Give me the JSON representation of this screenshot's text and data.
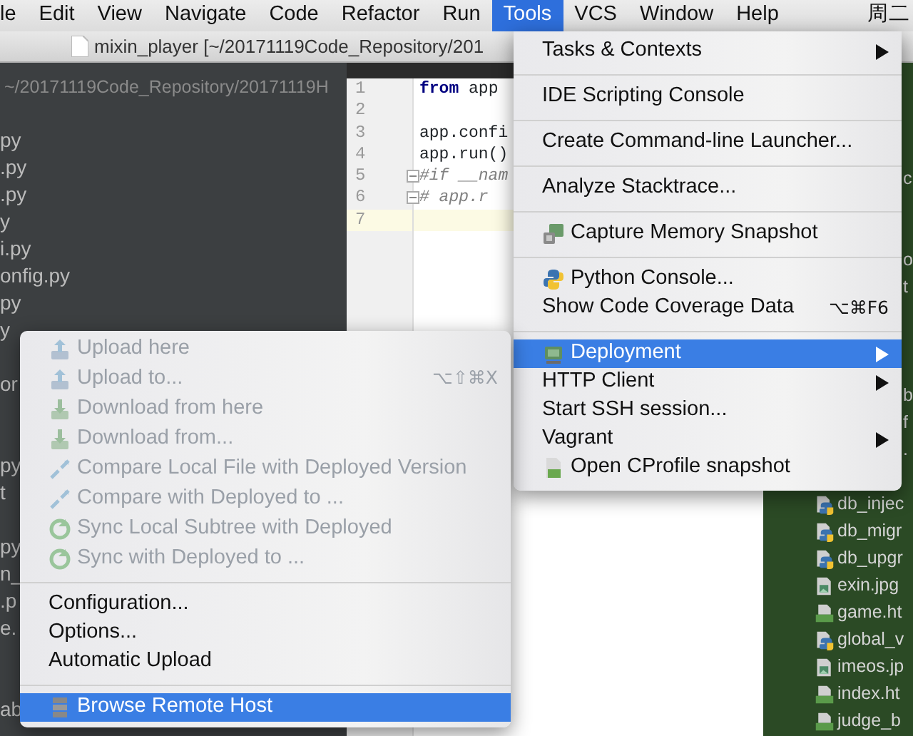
{
  "menubar": {
    "items": [
      {
        "label": "le",
        "selected": false
      },
      {
        "label": "Edit",
        "selected": false
      },
      {
        "label": "View",
        "selected": false
      },
      {
        "label": "Navigate",
        "selected": false
      },
      {
        "label": "Code",
        "selected": false
      },
      {
        "label": "Refactor",
        "selected": false
      },
      {
        "label": "Run",
        "selected": false
      },
      {
        "label": "Tools",
        "selected": true
      },
      {
        "label": "VCS",
        "selected": false
      },
      {
        "label": "Window",
        "selected": false
      },
      {
        "label": "Help",
        "selected": false
      }
    ],
    "clock": "周二"
  },
  "window": {
    "title": "mixin_player [~/20171119Code_Repository/201"
  },
  "project_panel": {
    "path": "~/20171119Code_Repository/20171119H",
    "items": [
      {
        "kind": "row",
        "label": "py"
      },
      {
        "kind": "row",
        "label": ".py"
      },
      {
        "kind": "row",
        "label": ".py"
      },
      {
        "kind": "row",
        "label": "y"
      },
      {
        "kind": "row",
        "label": "i.py"
      },
      {
        "kind": "row",
        "label": "onfig.py"
      },
      {
        "kind": "row",
        "label": "py"
      },
      {
        "kind": "row",
        "label": "y"
      },
      {
        "kind": "blank"
      },
      {
        "kind": "row",
        "label": "or"
      },
      {
        "kind": "blank"
      },
      {
        "kind": "blank"
      },
      {
        "kind": "row",
        "label": "py"
      },
      {
        "kind": "row",
        "label": "t"
      },
      {
        "kind": "blank"
      },
      {
        "kind": "row",
        "label": "py"
      },
      {
        "kind": "row",
        "label": "n_"
      },
      {
        "kind": "row",
        "label": ".p"
      },
      {
        "kind": "row",
        "label": "e."
      },
      {
        "kind": "blank"
      },
      {
        "kind": "blank"
      },
      {
        "kind": "row",
        "label": "ab"
      }
    ]
  },
  "editor": {
    "lines": [
      {
        "number": "1",
        "code": "**from** app",
        "kind": "code",
        "current": false
      },
      {
        "number": "2",
        "kind": "code",
        "current": false
      },
      {
        "number": "3",
        "code": "app.confi",
        "kind": "code",
        "current": false
      },
      {
        "number": "4",
        "code": "app.run()",
        "kind": "code",
        "current": false
      },
      {
        "number": "5",
        "code": "#if __nam",
        "kind": "fold-start",
        "current": false
      },
      {
        "number": "6",
        "code": "#   app.r",
        "kind": "fold-end",
        "current": false
      },
      {
        "number": "7",
        "kind": "code",
        "current": true
      }
    ]
  },
  "file_panel": {
    "items": [
      {
        "kind": "fragment",
        "label": "c"
      },
      {
        "kind": "blank"
      },
      {
        "kind": "blank"
      },
      {
        "kind": "fragment",
        "label": "o"
      },
      {
        "kind": "fragment",
        "label": "t"
      },
      {
        "kind": "blank"
      },
      {
        "kind": "blank"
      },
      {
        "kind": "blank"
      },
      {
        "kind": "fragment",
        "label": "b"
      },
      {
        "kind": "fragment",
        "label": "f"
      },
      {
        "kind": "fragment",
        "label": "."
      },
      {
        "kind": "blank"
      },
      {
        "kind": "python",
        "label": "db_injec"
      },
      {
        "kind": "python",
        "label": "db_migr"
      },
      {
        "kind": "python",
        "label": "db_upgr"
      },
      {
        "kind": "image",
        "label": "exin.jpg"
      },
      {
        "kind": "html",
        "label": "game.ht"
      },
      {
        "kind": "python",
        "label": "global_v"
      },
      {
        "kind": "image",
        "label": "imeos.jp"
      },
      {
        "kind": "html",
        "label": "index.ht"
      },
      {
        "kind": "html",
        "label": "judge_b"
      }
    ]
  },
  "tools_menu": {
    "items": [
      {
        "kind": "plain",
        "label": "Tasks & Contexts",
        "submenu": true,
        "selected": false
      },
      {
        "kind": "separator"
      },
      {
        "kind": "plain",
        "label": "IDE Scripting Console",
        "submenu": false,
        "selected": false
      },
      {
        "kind": "separator"
      },
      {
        "kind": "plain",
        "label": "Create Command-line Launcher...",
        "submenu": false,
        "selected": false
      },
      {
        "kind": "separator"
      },
      {
        "kind": "plain",
        "label": "Analyze Stacktrace...",
        "submenu": false,
        "selected": false
      },
      {
        "kind": "separator"
      },
      {
        "kind": "memory",
        "label": "Capture Memory Snapshot",
        "submenu": false,
        "selected": false
      },
      {
        "kind": "separator"
      },
      {
        "kind": "python",
        "label": "Python Console...",
        "submenu": false,
        "selected": false
      },
      {
        "kind": "plain",
        "label": "Show Code Coverage Data",
        "submenu": false,
        "selected": false,
        "shortcut": "⌥⌘F6"
      },
      {
        "kind": "separator"
      },
      {
        "kind": "server",
        "label": "Deployment",
        "submenu": true,
        "selected": true
      },
      {
        "kind": "plain",
        "label": "HTTP Client",
        "submenu": true,
        "selected": false
      },
      {
        "kind": "plain",
        "label": "Start SSH session...",
        "submenu": false,
        "selected": false
      },
      {
        "kind": "plain",
        "label": "Vagrant",
        "submenu": true,
        "selected": false
      },
      {
        "kind": "profile",
        "label": "Open CProfile snapshot",
        "submenu": false,
        "selected": false
      }
    ]
  },
  "deployment_menu": {
    "items": [
      {
        "kind": "upload",
        "label": "Upload here",
        "disabled": true,
        "selected": false
      },
      {
        "kind": "upload",
        "label": "Upload to...",
        "disabled": true,
        "selected": false,
        "shortcut": "⌥⇧⌘X"
      },
      {
        "kind": "download",
        "label": "Download from here",
        "disabled": true,
        "selected": false
      },
      {
        "kind": "download",
        "label": "Download from...",
        "disabled": true,
        "selected": false
      },
      {
        "kind": "compare",
        "label": "Compare Local File with Deployed Version",
        "disabled": true,
        "selected": false
      },
      {
        "kind": "compare",
        "label": "Compare with Deployed to ...",
        "disabled": true,
        "selected": false
      },
      {
        "kind": "sync",
        "label": "Sync Local Subtree with Deployed",
        "disabled": true,
        "selected": false
      },
      {
        "kind": "sync",
        "label": "Sync with Deployed to ...",
        "disabled": true,
        "selected": false
      },
      {
        "kind": "separator"
      },
      {
        "kind": "plain",
        "label": "Configuration...",
        "disabled": false,
        "selected": false
      },
      {
        "kind": "plain",
        "label": "Options...",
        "disabled": false,
        "selected": false
      },
      {
        "kind": "plain",
        "label": "Automatic Upload",
        "disabled": false,
        "selected": false
      },
      {
        "kind": "separator"
      },
      {
        "kind": "host",
        "label": "Browse Remote Host",
        "disabled": false,
        "selected": true
      }
    ]
  }
}
